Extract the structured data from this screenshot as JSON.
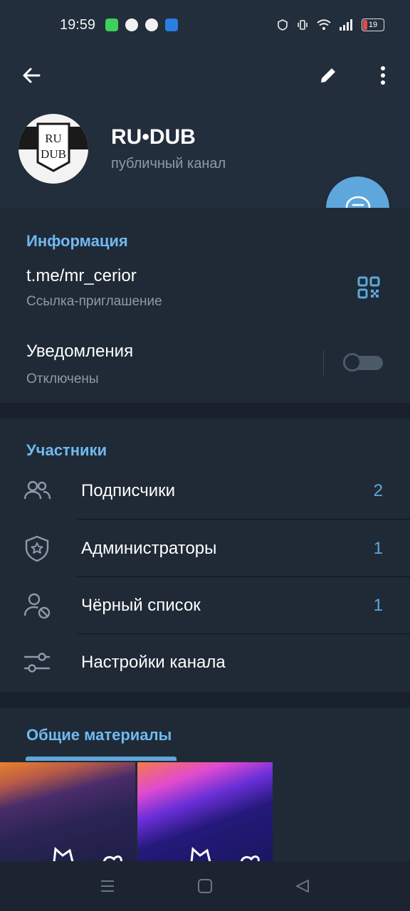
{
  "status_bar": {
    "time": "19:59",
    "battery": "19"
  },
  "header": {
    "channel_name": "RU•DUB",
    "channel_type": "публичный канал",
    "avatar_text_top": "RU",
    "avatar_text_bottom": "DUB"
  },
  "info": {
    "section_title": "Информация",
    "link": "t.me/mr_cerior",
    "link_caption": "Ссылка-приглашение",
    "notifications_label": "Уведомления",
    "notifications_state": "Отключены",
    "notifications_enabled": false
  },
  "participants": {
    "section_title": "Участники",
    "rows": [
      {
        "label": "Подписчики",
        "count": "2",
        "icon": "users-icon"
      },
      {
        "label": "Администраторы",
        "count": "1",
        "icon": "shield-star-icon"
      },
      {
        "label": "Чёрный список",
        "count": "1",
        "icon": "user-blocked-icon"
      },
      {
        "label": "Настройки канала",
        "count": "",
        "icon": "settings-sliders-icon"
      }
    ]
  },
  "shared": {
    "section_title": "Общие материалы"
  },
  "colors": {
    "accent": "#5ea7dc",
    "header_bg": "#232e3c",
    "section_bg": "#1f2a36",
    "page_bg": "#18212c"
  }
}
